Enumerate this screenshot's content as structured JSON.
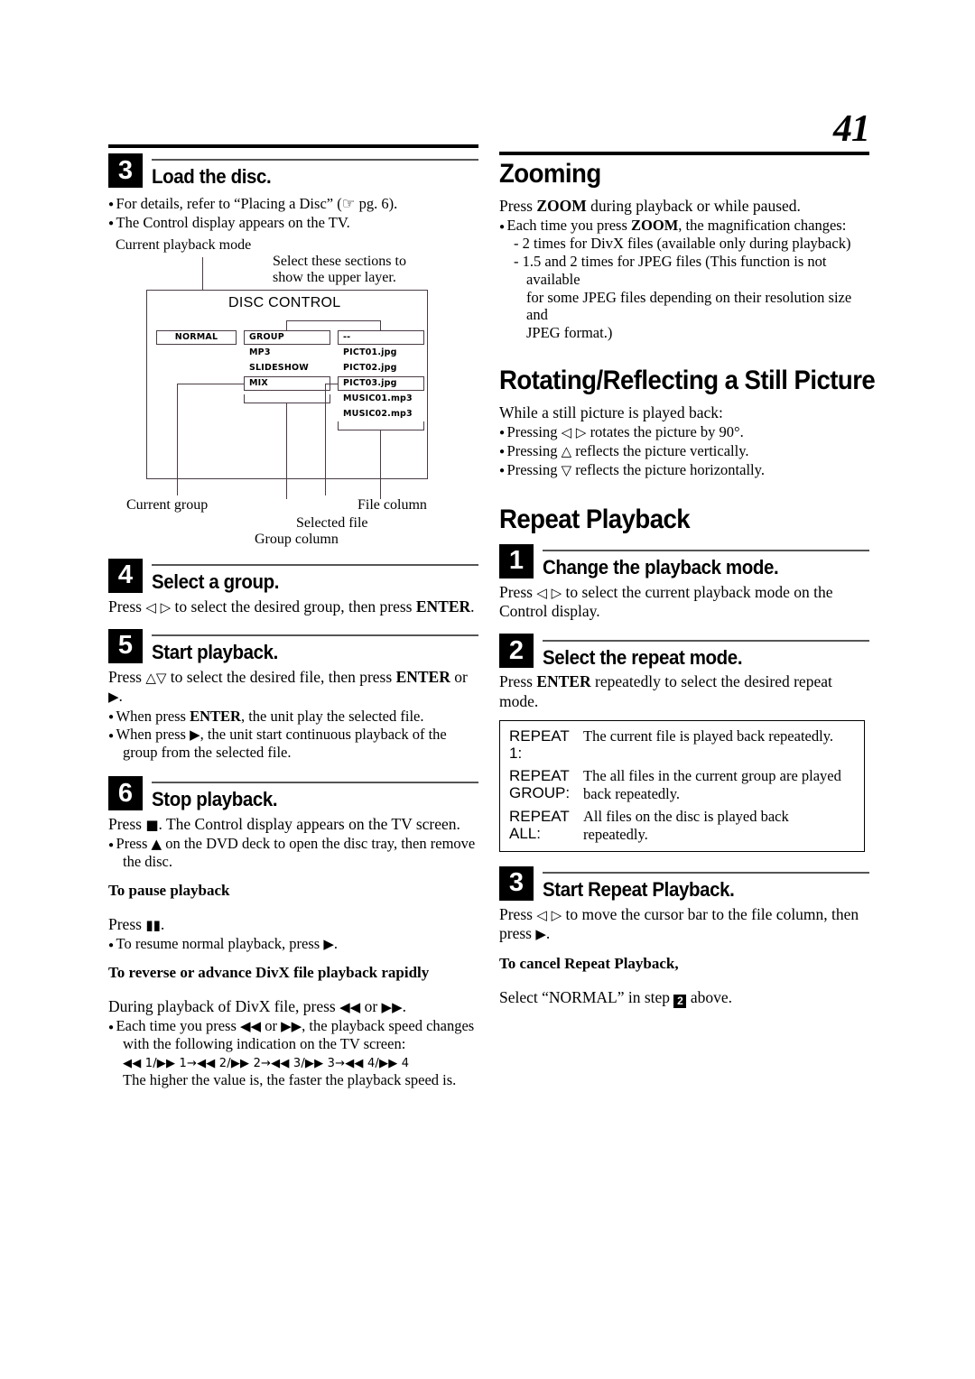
{
  "page": {
    "number": "41"
  },
  "left": {
    "step3": {
      "num": "3",
      "title": "Load the disc.",
      "bullets": [
        "For details, refer to “Placing a Disc” (☞ pg. 6).",
        "The Control display appears on the TV."
      ]
    },
    "diagram": {
      "label_current_playback_mode": "Current playback mode",
      "label_select_sections": "Select these sections to\nshow the upper layer.",
      "disc_control": "DISC CONTROL",
      "mode_cell": "NORMAL",
      "group_column": {
        "header": "GROUP",
        "items": [
          "MP3",
          "SLIDESHOW",
          "MIX"
        ]
      },
      "file_column": {
        "header": "--",
        "items": [
          "PICT01.jpg",
          "PICT02.jpg",
          "PICT03.jpg",
          "MUSIC01.mp3",
          "MUSIC02.mp3"
        ]
      },
      "label_current_group": "Current group",
      "label_group_column": "Group column",
      "label_selected_file": "Selected file",
      "label_file_column": "File column"
    },
    "step4": {
      "num": "4",
      "title": "Select a group.",
      "text_a": "Press ",
      "text_b": " to select the desired group, then press ",
      "enter": "ENTER",
      "text_c": "."
    },
    "step5": {
      "num": "5",
      "title": "Start playback.",
      "text_a": "Press ",
      "text_b": " to select the desired file, then press ",
      "enter": "ENTER",
      "text_c": " or ",
      "text_d": ".",
      "bullet1_a": "When press ",
      "bullet1_enter": "ENTER",
      "bullet1_b": ", the unit play the selected file.",
      "bullet2_a": "When press ",
      "bullet2_b": ", the unit start continuous playback of the",
      "bullet2_cont": "group from the selected file."
    },
    "step6": {
      "num": "6",
      "title": "Stop playback.",
      "text_a": "Press ",
      "text_b": ". The Control display appears on the TV screen.",
      "bullet_a": "Press ",
      "bullet_b": " on the DVD deck to open the disc tray, then remove",
      "bullet_cont": "the disc."
    },
    "pause": {
      "heading": "To pause playback",
      "text_a": "Press ",
      "text_b": ".",
      "bullet_a": "To resume normal playback, press ",
      "bullet_b": "."
    },
    "rapid": {
      "heading": "To reverse or advance DivX file playback rapidly",
      "line1_a": "During playback of DivX file, press ",
      "line1_b": " or ",
      "line1_c": ".",
      "bullet_a": "Each time you press ",
      "bullet_b": " or ",
      "bullet_c": ", the playback speed changes",
      "bullet_cont": "with the following indication on the TV screen:",
      "speeds": "1/▶▶ 1→◀◀ 2/▶▶ 2→◀◀ 3/▶▶ 3→◀◀ 4/▶▶ 4",
      "last": "The higher the value is, the faster the playback speed is."
    }
  },
  "right": {
    "zooming": {
      "heading": "Zooming",
      "line1_a": "Press ",
      "line1_zoom": "ZOOM",
      "line1_b": " during playback or while paused.",
      "bullet_a": "Each time you press ",
      "bullet_zoom": "ZOOM",
      "bullet_b": ", the magnification changes:",
      "sub1": "- 2 times for DivX files (available only during playback)",
      "sub2": "- 1.5 and 2 times for JPEG files (This function is not available",
      "sub2_cont1": "for some JPEG files depending on their resolution size and",
      "sub2_cont2": "JPEG format.)"
    },
    "rotating": {
      "heading": "Rotating/Reflecting a Still Picture",
      "intro": "While a still picture is played back:",
      "bullet1_a": "Pressing ",
      "bullet1_b": " rotates the picture by 90°.",
      "bullet2_a": "Pressing ",
      "bullet2_b": " reflects the picture vertically.",
      "bullet3_a": "Pressing ",
      "bullet3_b": " reflects the picture horizontally."
    },
    "repeat": {
      "heading": "Repeat Playback",
      "step1": {
        "num": "1",
        "title": "Change the playback mode.",
        "text_a": "Press ",
        "text_b": " to select the current playback mode on the",
        "text_cont": "Control display."
      },
      "step2": {
        "num": "2",
        "title": "Select the repeat mode.",
        "text_a": "Press ",
        "enter": "ENTER",
        "text_b": " repeatedly to select the desired repeat",
        "text_cont": "mode."
      },
      "table": [
        {
          "key": "REPEAT 1:",
          "value": "The current file is played back repeatedly."
        },
        {
          "key": "REPEAT GROUP:",
          "value": "The all files in the current group are played back repeatedly."
        },
        {
          "key": "REPEAT ALL:",
          "value": "All files on the disc is played back repeatedly."
        }
      ],
      "step3": {
        "num": "3",
        "title": "Start Repeat Playback.",
        "text_a": "Press ",
        "text_b": " to move the cursor bar to the file column, then",
        "text_cont_a": "press ",
        "text_cont_b": "."
      },
      "cancel": {
        "heading": "To cancel Repeat Playback,",
        "text_a": "Select “NORMAL” in step ",
        "step_badge": "2",
        "text_b": " above."
      }
    }
  }
}
